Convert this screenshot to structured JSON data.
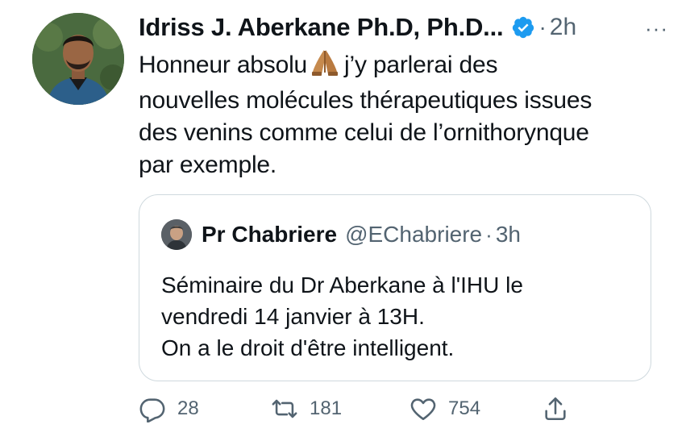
{
  "tweet": {
    "author_name": "Idriss J. Aberkane Ph.D, Ph.D...",
    "separator": "·",
    "time": "2h",
    "more": "···",
    "text_lines": [
      "Honneur absolu",
      "j’y parlerai des",
      "nouvelles molécules thérapeutiques issues",
      "des venins comme celui de l’ornithorynque",
      "par exemple."
    ],
    "emoji": "folded-hands"
  },
  "quoted": {
    "author_name": "Pr Chabriere",
    "handle": "@EChabriere",
    "separator": "·",
    "time": "3h",
    "text_lines": [
      "Séminaire du Dr  Aberkane à l'IHU le",
      "vendredi 14 janvier à 13H.",
      "On a le droit d'être intelligent."
    ]
  },
  "actions": {
    "replies": "28",
    "retweets": "181",
    "likes": "754"
  },
  "colors": {
    "text": "#0f1419",
    "secondary": "#536471",
    "verified": "#1d9bf0",
    "border": "#cfd9de"
  },
  "icons": [
    "verified-badge-icon",
    "more-icon",
    "reply-icon",
    "retweet-icon",
    "like-icon",
    "share-icon"
  ]
}
